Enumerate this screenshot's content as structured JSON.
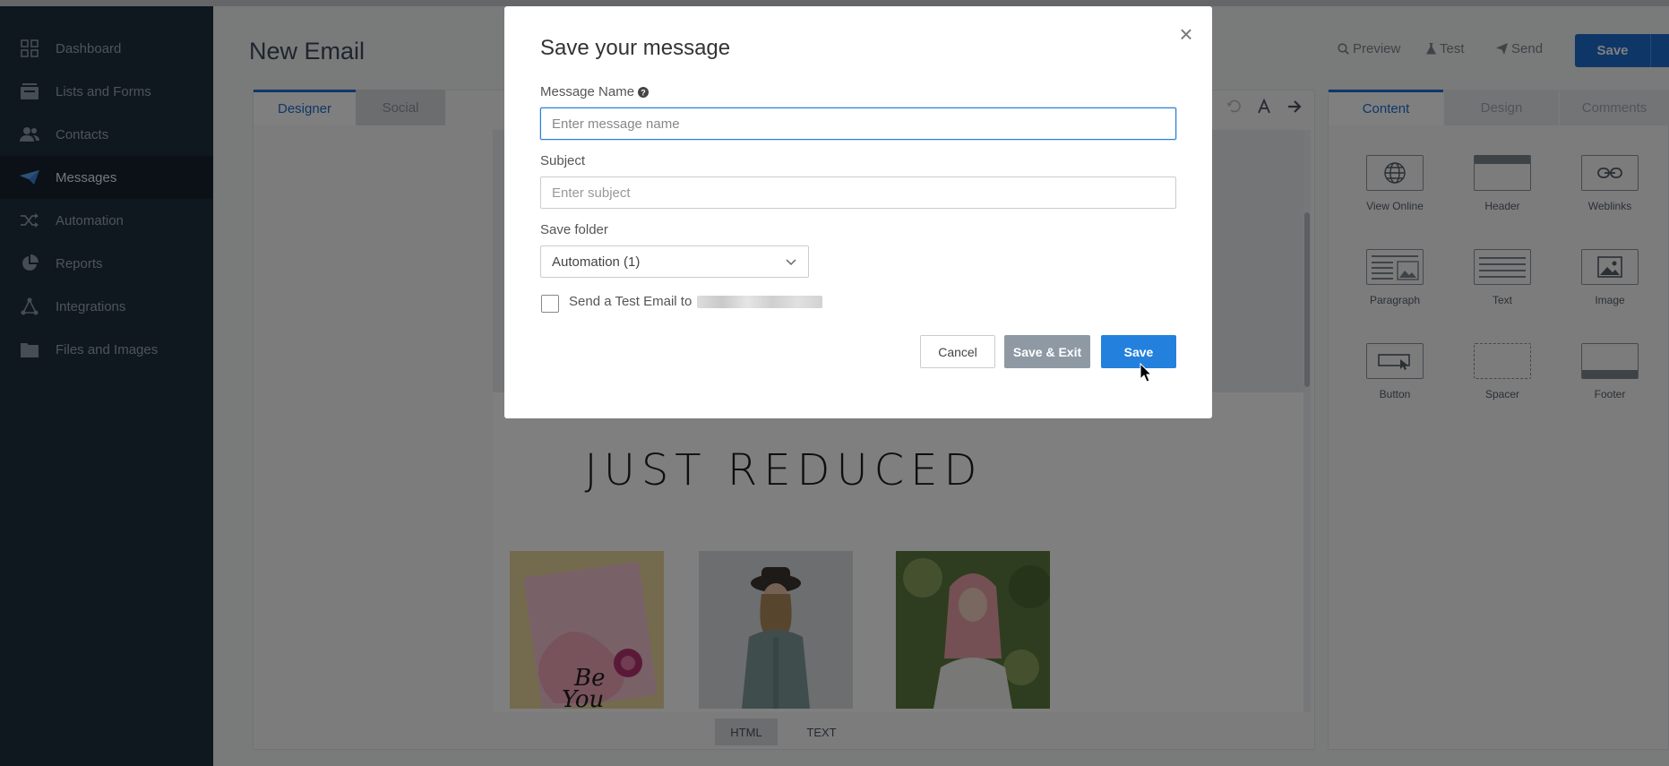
{
  "sidebar": {
    "items": [
      {
        "label": "Dashboard",
        "icon": "grid-icon",
        "active": false
      },
      {
        "label": "Lists and Forms",
        "icon": "list-icon",
        "active": false
      },
      {
        "label": "Contacts",
        "icon": "contacts-icon",
        "active": false
      },
      {
        "label": "Messages",
        "icon": "paper-plane-icon",
        "active": true
      },
      {
        "label": "Automation",
        "icon": "shuffle-icon",
        "active": false
      },
      {
        "label": "Reports",
        "icon": "pie-chart-icon",
        "active": false
      },
      {
        "label": "Integrations",
        "icon": "network-icon",
        "active": false
      },
      {
        "label": "Files and Images",
        "icon": "folder-icon",
        "active": false
      }
    ]
  },
  "header": {
    "title": "New Email",
    "preview_label": "Preview",
    "test_label": "Test",
    "send_label": "Send",
    "save_label": "Save"
  },
  "designer": {
    "tabs": [
      "Designer",
      "Social"
    ],
    "headline": "JUST REDUCED",
    "bottom_toggles": [
      "HTML",
      "TEXT"
    ]
  },
  "right_panel": {
    "tabs": [
      "Content",
      "Design",
      "Comments"
    ],
    "blocks": [
      "View Online",
      "Header",
      "Weblinks",
      "Paragraph",
      "Text",
      "Image",
      "Button",
      "Spacer",
      "Footer"
    ]
  },
  "modal": {
    "title": "Save your message",
    "message_name_label": "Message Name",
    "message_name_placeholder": "Enter message name",
    "subject_label": "Subject",
    "subject_placeholder": "Enter subject",
    "folder_label": "Save folder",
    "folder_value": "Automation (1)",
    "test_email_label": "Send a Test Email to",
    "cancel_label": "Cancel",
    "save_exit_label": "Save & Exit",
    "save_label": "Save"
  },
  "colors": {
    "sidebar_bg": "#1f2f3f",
    "accent": "#1c6fd0",
    "save_exit_bg": "#8e99a4"
  }
}
